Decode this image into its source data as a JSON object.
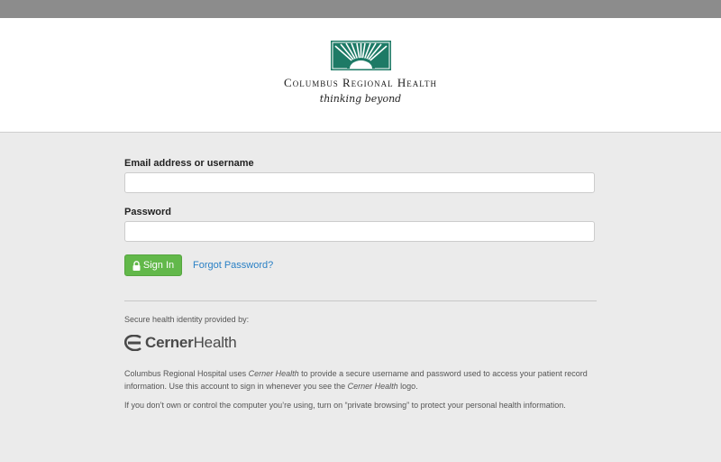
{
  "header": {
    "brand_name": "Columbus Regional Health",
    "tagline": "thinking beyond"
  },
  "login_form": {
    "username_label": "Email address or username",
    "username_value": "",
    "password_label": "Password",
    "password_value": "",
    "signin_button": "Sign In",
    "forgot_password_link": "Forgot Password?"
  },
  "provider": {
    "provided_by": "Secure health identity provided by:",
    "logo_text_bold": "Cerner",
    "logo_text_regular": "Health",
    "info_paragraph_1": {
      "part1": "Columbus Regional Hospital uses ",
      "em1": "Cerner Health",
      "part2": " to provide a secure username and password used to access your patient record information. Use this account to sign in whenever you see the ",
      "em2": "Cerner Health",
      "part3": " logo."
    },
    "info_paragraph_2": "If you don’t own or control the computer you’re using, turn on “private browsing” to protect your personal health information."
  },
  "colors": {
    "top_bar": "#8c8c8c",
    "page_background": "#ebebeb",
    "brand_green": "#1d7a66",
    "signin_green": "#62b84a",
    "link_blue": "#2a80c5"
  },
  "icons": [
    "sunburst-logo-icon",
    "lock-icon",
    "cerner-logo-icon"
  ]
}
